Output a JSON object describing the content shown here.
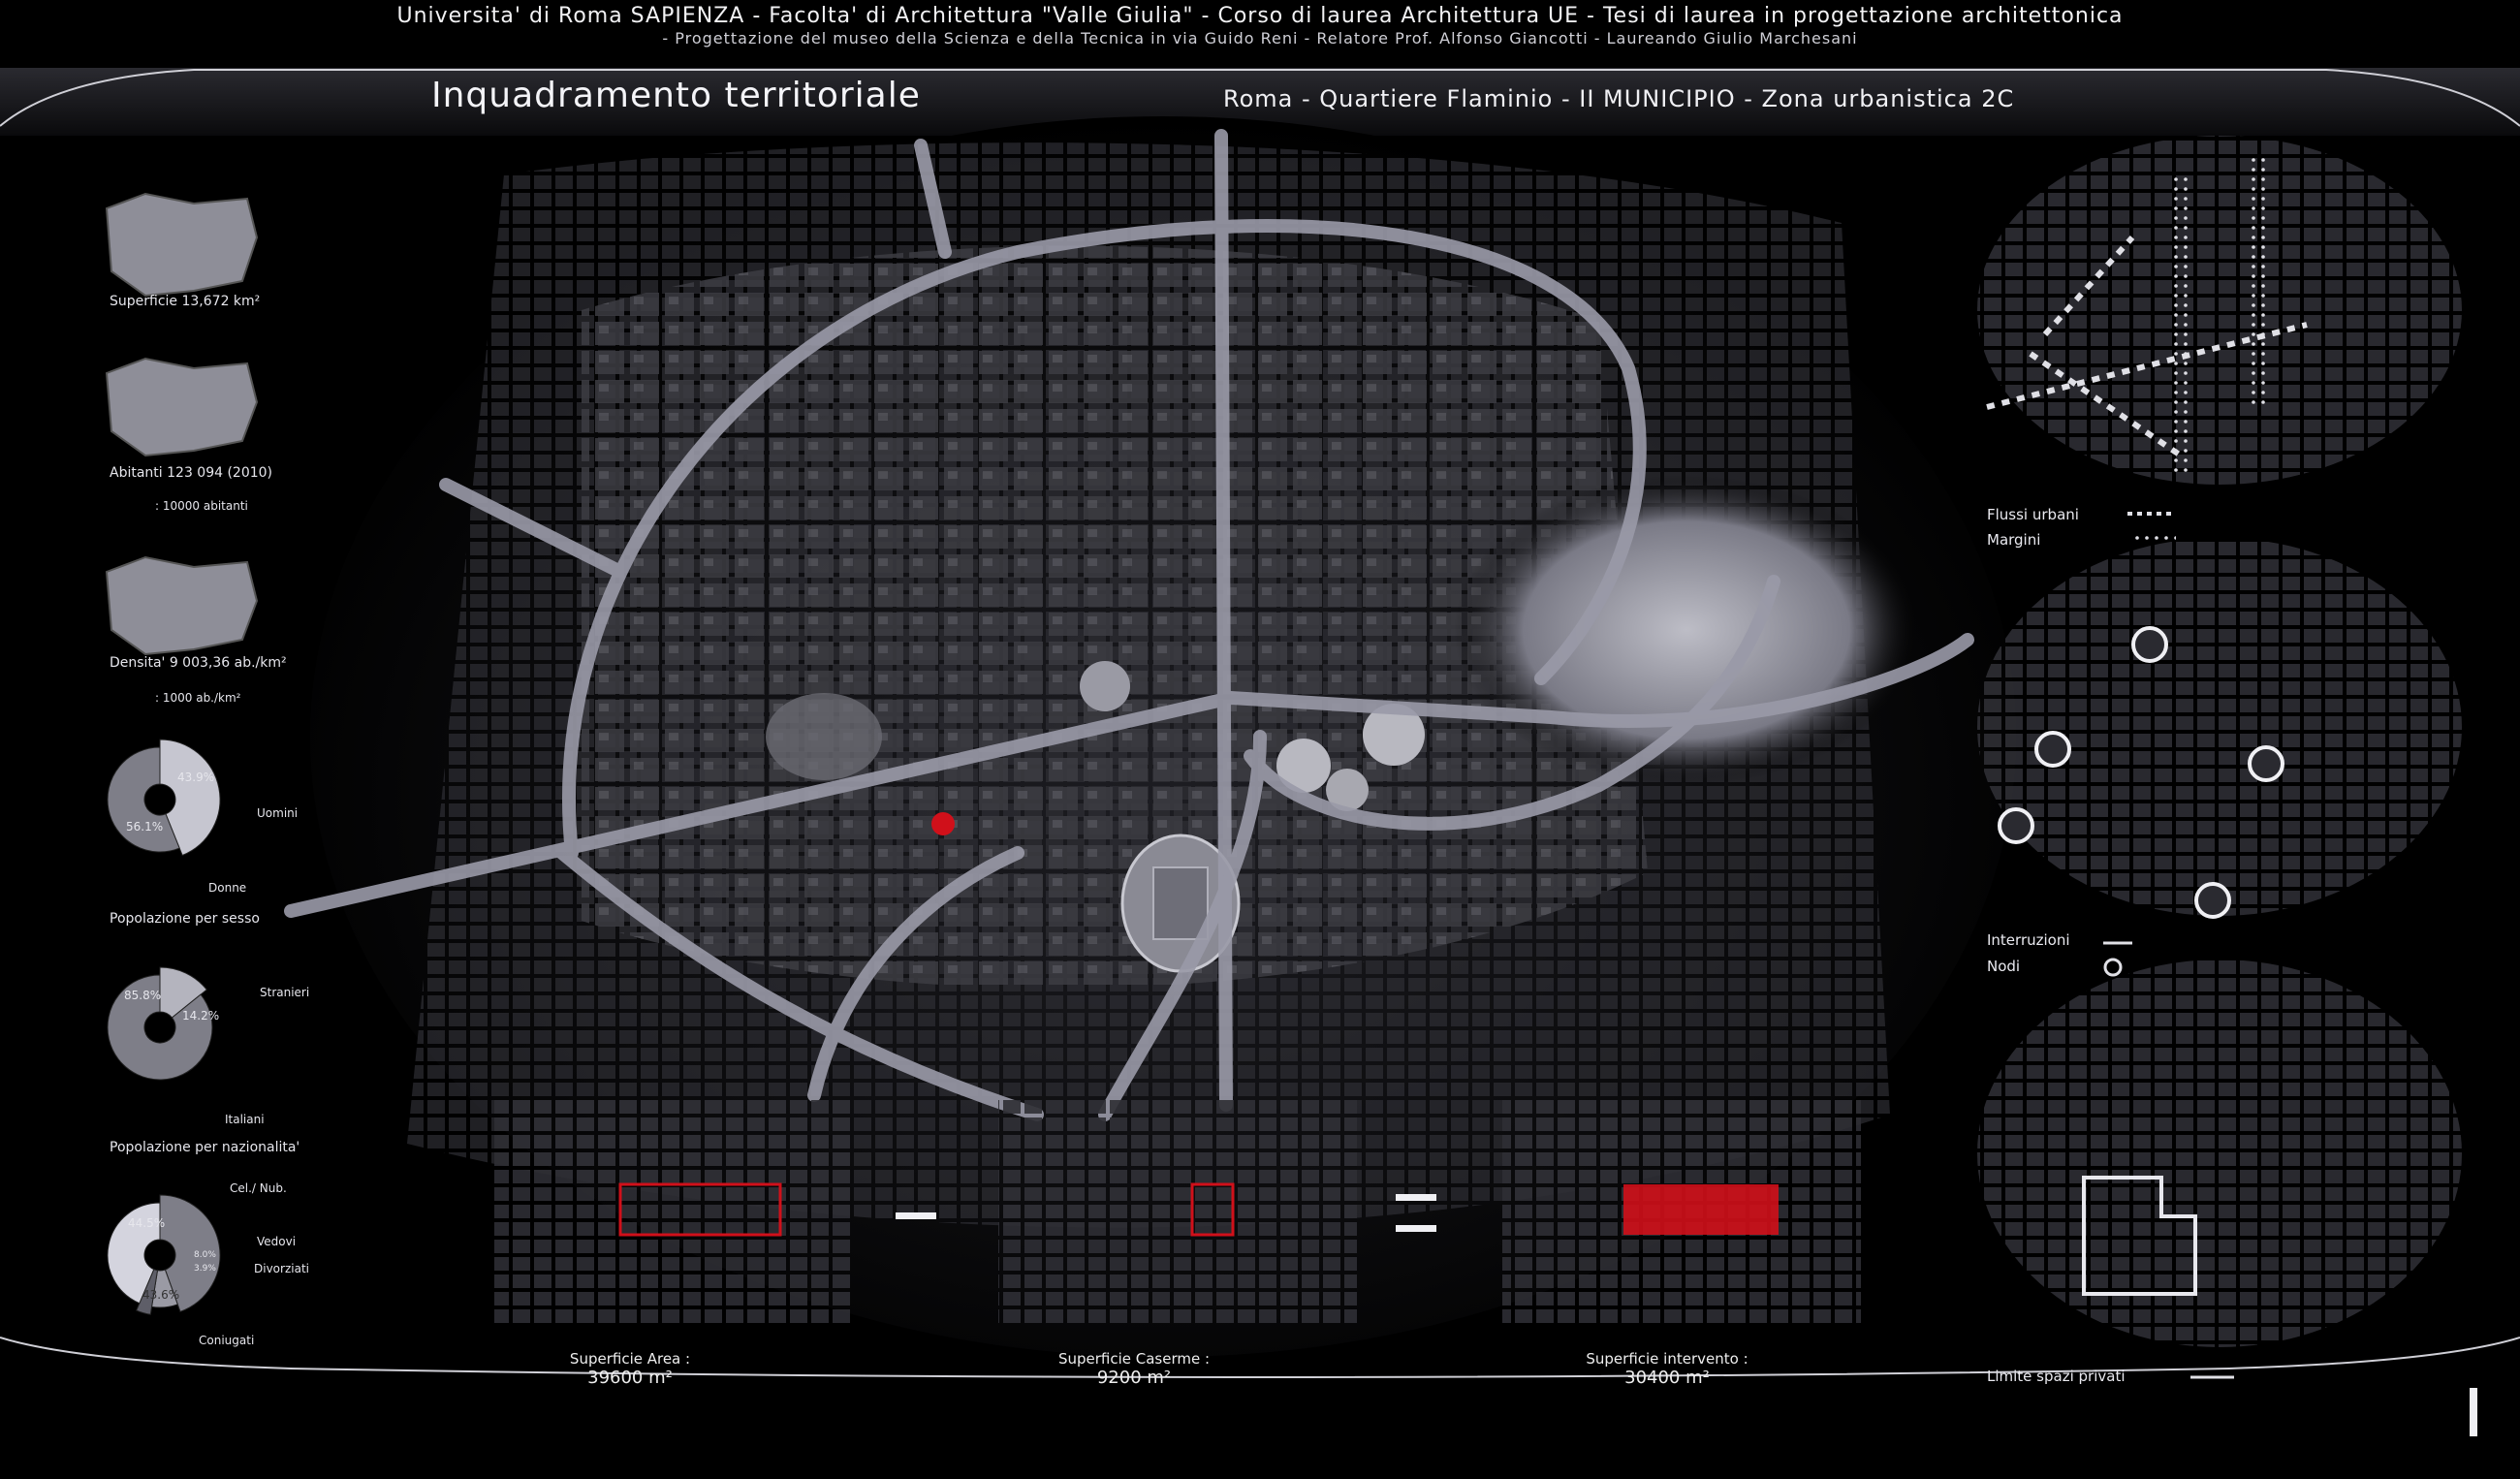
{
  "header": {
    "line1": "Universita' di Roma SAPIENZA  -  Facolta' di Architettura  \"Valle Giulia\"  -  Corso di laurea  Architettura UE  -  Tesi di laurea in progettazione architettonica",
    "line2": "- Progettazione del museo della Scienza e della Tecnica in via Guido Reni - Relatore Prof. Alfonso Giancotti  -  Laureando Giulio Marchesani",
    "title": "Inquadramento territoriale",
    "subtitle": "Roma - Quartiere Flaminio - II MUNICIPIO - Zona urbanistica 2C"
  },
  "left_panel": {
    "superficie": "Superficie  13,672 km²",
    "abitanti": "Abitanti 123 094 (2010)",
    "abitanti_legend": ": 10000 abitanti",
    "densita": "Densita' 9 003,36 ab./km²",
    "densita_legend": ": 1000 ab./km²",
    "sesso": {
      "title": "Popolazione per sesso",
      "slices": [
        {
          "label": "Uomini",
          "value_text": "43.9%",
          "value": 43.9
        },
        {
          "label": "Donne",
          "value_text": "56.1%",
          "value": 56.1
        }
      ]
    },
    "nazionalita": {
      "title": "Popolazione per nazionalita'",
      "slices": [
        {
          "label": "Stranieri",
          "value_text": "14.2%",
          "value": 14.2
        },
        {
          "label": "Italiani",
          "value_text": "85.8%",
          "value": 85.8
        }
      ]
    },
    "stato_civile": {
      "slices": [
        {
          "label": "Cel./ Nub.",
          "value_text": "44.5%",
          "value": 44.5
        },
        {
          "label": "Vedovi",
          "value_text": "8.0%",
          "value": 8.0
        },
        {
          "label": "Divorziati",
          "value_text": "3.9%",
          "value": 3.9
        },
        {
          "label": "Coniugati",
          "value_text": "43.6%",
          "value": 43.6
        }
      ]
    }
  },
  "bottom": {
    "area_label": "Superficie   Area :",
    "area_value": "39600 m²",
    "caserme_label": "Superficie   Caserme :",
    "caserme_value": "9200 m²",
    "intervento_label": "Superficie  intervento :",
    "intervento_value": "30400 m²",
    "minus": "-",
    "equals": "="
  },
  "right_panel": {
    "flussi": "Flussi urbani",
    "margini": "Margini",
    "interruzioni": "Interruzioni",
    "nodi": "Nodi",
    "limite": "Limite spazi privati"
  },
  "page_marker": "I",
  "colors": {
    "accent_red": "#d0101a",
    "road": "#9a9aa8",
    "block": "#4a4a50",
    "bg": "#000000"
  }
}
